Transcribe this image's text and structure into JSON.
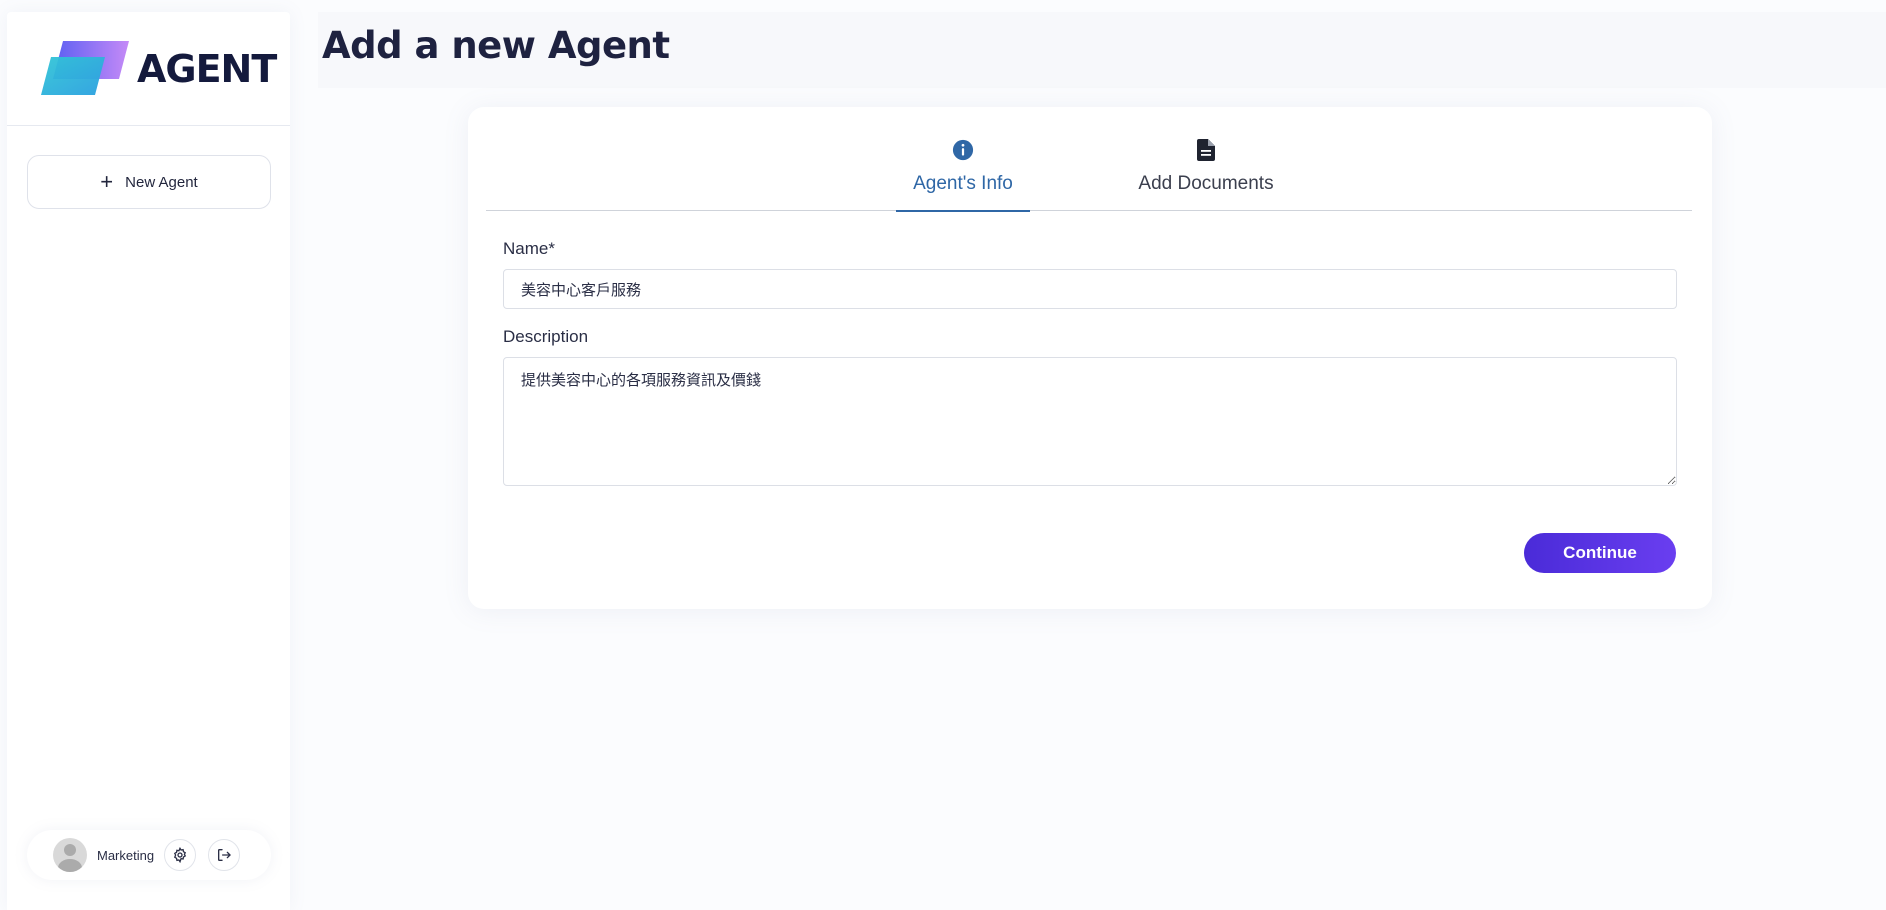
{
  "brand": {
    "name": "AGENT"
  },
  "sidebar": {
    "new_agent_label": "New Agent",
    "user": {
      "name": "Marketing"
    }
  },
  "header": {
    "title": "Add a new Agent"
  },
  "tabs": [
    {
      "label": "Agent's Info",
      "icon": "info-icon",
      "active": true
    },
    {
      "label": "Add Documents",
      "icon": "document-icon",
      "active": false
    }
  ],
  "form": {
    "name": {
      "label": "Name*",
      "value": "美容中心客戶服務"
    },
    "description": {
      "label": "Description",
      "value": "提供美容中心的各項服務資訊及價錢"
    },
    "continue_label": "Continue"
  },
  "colors": {
    "accent": "#2f67a6",
    "primary_button_start": "#4a2bd8",
    "primary_button_end": "#6a3ef0",
    "title": "#1e2240"
  }
}
